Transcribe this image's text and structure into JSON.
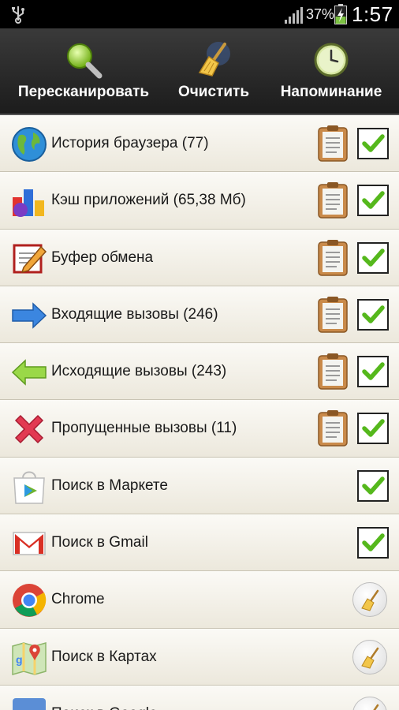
{
  "status_bar": {
    "battery_percent": "37%",
    "time": "1:57"
  },
  "toolbar": {
    "rescan_label": "Пересканировать",
    "clean_label": "Очистить",
    "remind_label": "Напоминание"
  },
  "items": [
    {
      "label": "История браузера (77)",
      "icon": "globe-icon",
      "has_details": true,
      "control": "checkbox",
      "checked": true
    },
    {
      "label": "Кэш приложений (65,38 Мб)",
      "icon": "app-cache-icon",
      "has_details": true,
      "control": "checkbox",
      "checked": true
    },
    {
      "label": "Буфер обмена",
      "icon": "clipboard-pencil-icon",
      "has_details": true,
      "control": "checkbox",
      "checked": true
    },
    {
      "label": "Входящие вызовы (246)",
      "icon": "arrow-right-icon",
      "has_details": true,
      "control": "checkbox",
      "checked": true
    },
    {
      "label": "Исходящие вызовы (243)",
      "icon": "arrow-left-icon",
      "has_details": true,
      "control": "checkbox",
      "checked": true
    },
    {
      "label": "Пропущенные вызовы (11)",
      "icon": "red-cross-icon",
      "has_details": true,
      "control": "checkbox",
      "checked": true
    },
    {
      "label": "Поиск в Маркете",
      "icon": "play-store-icon",
      "has_details": false,
      "control": "checkbox",
      "checked": true
    },
    {
      "label": "Поиск в Gmail",
      "icon": "gmail-icon",
      "has_details": false,
      "control": "checkbox",
      "checked": true
    },
    {
      "label": "Chrome",
      "icon": "chrome-icon",
      "has_details": false,
      "control": "broom",
      "checked": false
    },
    {
      "label": "Поиск в Картах",
      "icon": "maps-icon",
      "has_details": false,
      "control": "broom",
      "checked": false
    },
    {
      "label": "Поиск в Google",
      "icon": "google-search-icon",
      "has_details": false,
      "control": "broom",
      "checked": false
    }
  ],
  "colors": {
    "check_mark": "#55b81c",
    "toolbar_bg": "#2a2a2a",
    "list_bg": "#f4f1e8"
  }
}
